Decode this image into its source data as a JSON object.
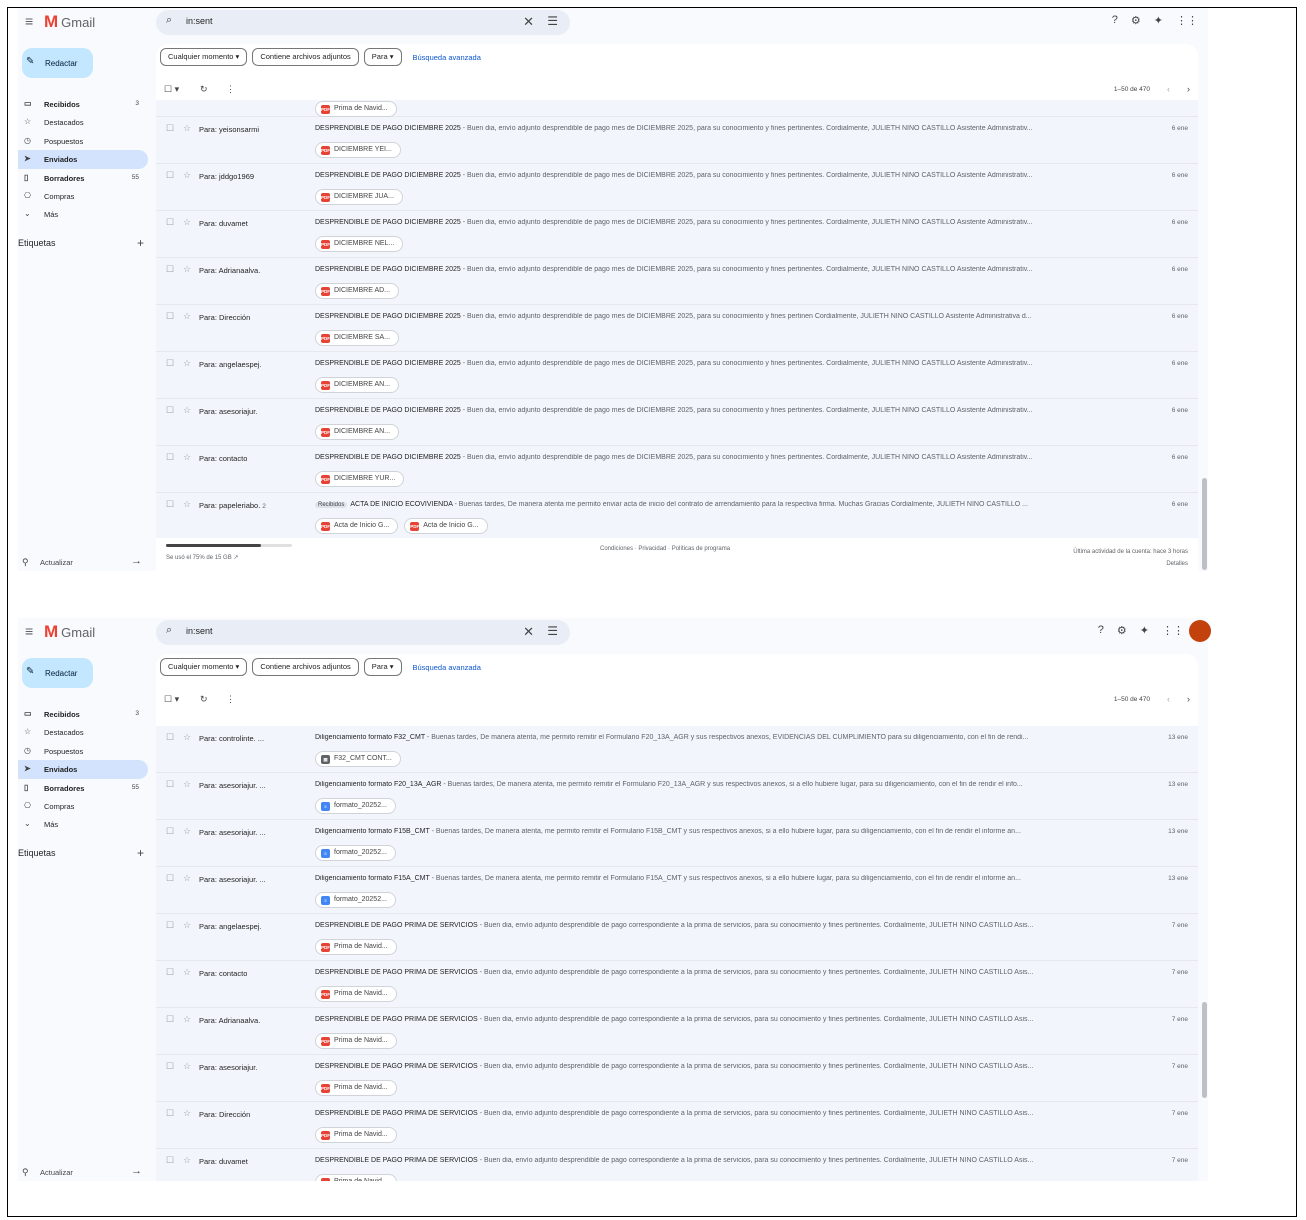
{
  "app": {
    "name": "Gmail"
  },
  "search": {
    "value": "in:sent"
  },
  "compose": {
    "label": "Redactar"
  },
  "nav": [
    {
      "label": "Recibidos",
      "count": "3",
      "icon": "inbox-icon",
      "glyph": "▭",
      "bold": true
    },
    {
      "label": "Destacados",
      "count": "",
      "icon": "star-icon",
      "glyph": "☆"
    },
    {
      "label": "Pospuestos",
      "count": "",
      "icon": "clock-icon",
      "glyph": "◷"
    },
    {
      "label": "Enviados",
      "count": "",
      "icon": "send-icon",
      "glyph": "➤",
      "active": true
    },
    {
      "label": "Borradores",
      "count": "55",
      "icon": "draft-icon",
      "glyph": "▯",
      "bold": true
    },
    {
      "label": "Compras",
      "count": "",
      "icon": "shopping-icon",
      "glyph": "⎔"
    },
    {
      "label": "Más",
      "count": "",
      "icon": "chevron-down-icon",
      "glyph": "⌄"
    }
  ],
  "labels": {
    "title1": "Etiquetas",
    "title2": "Etiquetas"
  },
  "update": {
    "label": "Actualizar"
  },
  "filters": {
    "time": "Cualquier momento",
    "attachments": "Contiene archivos adjuntos",
    "to": "Para",
    "advanced": "Búsqueda avanzada"
  },
  "pagination": {
    "text": "1–50 de 470"
  },
  "footer": {
    "storage": "Se usó el 75% de 15 GB",
    "storage_fraction": 0.75,
    "links": "Condiciones · Privacidad · Políticas de programa",
    "activity": "Última actividad de la cuenta: hace 3 horas",
    "details": "Detalles"
  },
  "shot1": {
    "top_attachment": "Prima de Navid...",
    "rows": [
      {
        "to": "Para: yeisonsarmi",
        "count": "",
        "tag": "",
        "subject": "DESPRENDIBLE DE PAGO DICIEMBRE 2025",
        "snippet": " - Buen dia, envío adjunto desprendible de pago mes de DICIEMBRE 2025, para su conocimiento y fines pertinentes. Cordialmente, JULIETH NIÑO CASTILLO Asistente Administrativ...",
        "date": "6 ene",
        "attachments": [
          {
            "label": "DICIEMBRE YEI...",
            "type": "pdf"
          }
        ]
      },
      {
        "to": "Para: jddgo1969",
        "count": "",
        "tag": "",
        "subject": "DESPRENDIBLE DE PAGO DICIEMBRE 2025",
        "snippet": " - Buen dia, envío adjunto desprendible de pago mes de DICIEMBRE 2025, para su conocimiento y fines pertinentes. Cordialmente, JULIETH NIÑO CASTILLO Asistente Administrativ...",
        "date": "6 ene",
        "attachments": [
          {
            "label": "DICIEMBRE JUA...",
            "type": "pdf"
          }
        ]
      },
      {
        "to": "Para: duvamet",
        "count": "",
        "tag": "",
        "subject": "DESPRENDIBLE DE PAGO DICIEMBRE 2025",
        "snippet": " - Buen dia, envío adjunto desprendible de pago mes de DICIEMBRE 2025, para su conocimiento y fines pertinentes. Cordialmente, JULIETH NIÑO CASTILLO Asistente Administrativ...",
        "date": "6 ene",
        "attachments": [
          {
            "label": "DICIEMBRE NEL...",
            "type": "pdf"
          }
        ]
      },
      {
        "to": "Para: Adrianaalva.",
        "count": "",
        "tag": "",
        "subject": "DESPRENDIBLE DE PAGO DICIEMBRE 2025",
        "snippet": " - Buen dia, envío adjunto desprendible de pago mes de DICIEMBRE 2025, para su conocimiento y fines pertinentes. Cordialmente, JULIETH NIÑO CASTILLO Asistente Administrativ...",
        "date": "6 ene",
        "attachments": [
          {
            "label": "DICIEMBRE AD...",
            "type": "pdf"
          }
        ]
      },
      {
        "to": "Para: Dirección",
        "count": "",
        "tag": "",
        "subject": "DESPRENDIBLE DE PAGO DICIEMBRE 2025",
        "snippet": " - Buen dia, envío adjunto desprendible de pago mes de DICIEMBRE 2025, para su conocimiento y fines pertinen Cordialmente, JULIETH NIÑO CASTILLO Asistente Administrativa d...",
        "date": "6 ene",
        "attachments": [
          {
            "label": "DICIEMBRE SA...",
            "type": "pdf"
          }
        ]
      },
      {
        "to": "Para: angelaespej.",
        "count": "",
        "tag": "",
        "subject": "DESPRENDIBLE DE PAGO DICIEMBRE 2025",
        "snippet": " - Buen dia, envío adjunto desprendible de pago mes de DICIEMBRE 2025, para su conocimiento y fines pertinentes. Cordialmente, JULIETH NIÑO CASTILLO Asistente Administrativ...",
        "date": "6 ene",
        "attachments": [
          {
            "label": "DICIEMBRE AN...",
            "type": "pdf"
          }
        ]
      },
      {
        "to": "Para: asesoriajur.",
        "count": "",
        "tag": "",
        "subject": "DESPRENDIBLE DE PAGO DICIEMBRE 2025",
        "snippet": " - Buen dia, envío adjunto desprendible de pago mes de DICIEMBRE 2025, para su conocimiento y fines pertinentes. Cordialmente, JULIETH NIÑO CASTILLO Asistente Administrativ...",
        "date": "6 ene",
        "attachments": [
          {
            "label": "DICIEMBRE AN...",
            "type": "pdf"
          }
        ]
      },
      {
        "to": "Para: contacto",
        "count": "",
        "tag": "",
        "subject": "DESPRENDIBLE DE PAGO DICIEMBRE 2025",
        "snippet": " - Buen dia, envío adjunto desprendible de pago mes de DICIEMBRE 2025, para su conocimiento y fines pertinentes. Cordialmente, JULIETH NIÑO CASTILLO Asistente Administrativ...",
        "date": "6 ene",
        "attachments": [
          {
            "label": "DICIEMBRE YUR...",
            "type": "pdf"
          }
        ]
      },
      {
        "to": "Para: papeleriabo.",
        "count": "2",
        "tag": "Recibidos",
        "subject": "ACTA DE INICIO ECOVIVIENDA",
        "snippet": " - Buenas tardes, De manera atenta me permito enviar acta de inicio del contrato de arrendamiento para la respectiva firma. Muchas Gracias Cordialmente, JULIETH NIÑO CASTILLO ...",
        "date": "6 ene",
        "attachments": [
          {
            "label": "Acta de Inicio G...",
            "type": "pdf"
          },
          {
            "label": "Acta de Inicio G...",
            "type": "pdf"
          }
        ]
      }
    ]
  },
  "shot2": {
    "rows": [
      {
        "to": "Para: controlinte. ...",
        "count": "",
        "tag": "",
        "subject": "Diligenciamiento formato F32_CMT",
        "snippet": " - Buenas tardes, De manera atenta, me permito remitir el Formulario F20_13A_AGR y sus respectivos anexos, EVIDENCIAS DEL CUMPLIMIENTO para su diligenciamiento, con el fin de rendi...",
        "date": "13 ene",
        "attachments": [
          {
            "label": "F32_CMT CONT...",
            "type": "xls"
          }
        ]
      },
      {
        "to": "Para: asesoriajur. ...",
        "count": "",
        "tag": "",
        "subject": "Diligenciamiento formato F20_13A_AGR",
        "snippet": " - Buenas tardes, De manera atenta, me permito remitir el Formulario F20_13A_AGR y sus respectivos anexos, si a ello hubiere lugar, para su diligenciamiento, con el fin de rendir el info...",
        "date": "13 ene",
        "attachments": [
          {
            "label": "formato_20252...",
            "type": "doc"
          }
        ]
      },
      {
        "to": "Para: asesoriajur. ...",
        "count": "",
        "tag": "",
        "subject": "Diligenciamiento formato F15B_CMT",
        "snippet": " - Buenas tardes, De manera atenta, me permito remitir el Formulario F15B_CMT y sus respectivos anexos, si a ello hubiere lugar, para su diligenciamiento, con el fin de rendir el informe an...",
        "date": "13 ene",
        "attachments": [
          {
            "label": "formato_20252...",
            "type": "doc"
          }
        ]
      },
      {
        "to": "Para: asesoriajur. ...",
        "count": "",
        "tag": "",
        "subject": "Diligenciamiento formato F15A_CMT",
        "snippet": " - Buenas tardes, De manera atenta, me permito remitir el Formulario F15A_CMT y sus respectivos anexos, si a ello hubiere lugar, para su diligenciamiento, con el fin de rendir el informe an...",
        "date": "13 ene",
        "attachments": [
          {
            "label": "formato_20252...",
            "type": "doc"
          }
        ]
      },
      {
        "to": "Para: angelaespej.",
        "count": "",
        "tag": "",
        "subject": "DESPRENDIBLE DE PAGO PRIMA DE SERVICIOS",
        "snippet": " - Buen dia, envío adjunto desprendible de pago correspondiente a la prima de servicios, para su conocimiento y fines pertinentes. Cordialmente, JULIETH NIÑO CASTILLO Asis...",
        "date": "7 ene",
        "attachments": [
          {
            "label": "Prima de Navid...",
            "type": "pdf"
          }
        ]
      },
      {
        "to": "Para: contacto",
        "count": "",
        "tag": "",
        "subject": "DESPRENDIBLE DE PAGO PRIMA DE SERVICIOS",
        "snippet": " - Buen dia, envío adjunto desprendible de pago correspondiente a la prima de servicios, para su conocimiento y fines pertinentes. Cordialmente, JULIETH NIÑO CASTILLO Asis...",
        "date": "7 ene",
        "attachments": [
          {
            "label": "Prima de Navid...",
            "type": "pdf"
          }
        ]
      },
      {
        "to": "Para: Adrianaalva.",
        "count": "",
        "tag": "",
        "subject": "DESPRENDIBLE DE PAGO PRIMA DE SERVICIOS",
        "snippet": " - Buen dia, envío adjunto desprendible de pago correspondiente a la prima de servicios, para su conocimiento y fines pertinentes. Cordialmente, JULIETH NIÑO CASTILLO Asis...",
        "date": "7 ene",
        "attachments": [
          {
            "label": "Prima de Navid...",
            "type": "pdf"
          }
        ]
      },
      {
        "to": "Para: asesoriajur.",
        "count": "",
        "tag": "",
        "subject": "DESPRENDIBLE DE PAGO PRIMA DE SERVICIOS",
        "snippet": " - Buen dia, envío adjunto desprendible de pago correspondiente a la prima de servicios, para su conocimiento y fines pertinentes. Cordialmente, JULIETH NIÑO CASTILLO Asis...",
        "date": "7 ene",
        "attachments": [
          {
            "label": "Prima de Navid...",
            "type": "pdf"
          }
        ]
      },
      {
        "to": "Para: Dirección",
        "count": "",
        "tag": "",
        "subject": "DESPRENDIBLE DE PAGO PRIMA DE SERVICIOS",
        "snippet": " - Buen dia, envío adjunto desprendible de pago correspondiente a la prima de servicios, para su conocimiento y fines pertinentes. Cordialmente, JULIETH NIÑO CASTILLO Asis...",
        "date": "7 ene",
        "attachments": [
          {
            "label": "Prima de Navid...",
            "type": "pdf"
          }
        ]
      },
      {
        "to": "Para: duvamet",
        "count": "",
        "tag": "",
        "subject": "DESPRENDIBLE DE PAGO PRIMA DE SERVICIOS",
        "snippet": " - Buen dia, envío adjunto desprendible de pago correspondiente a la prima de servicios, para su conocimiento y fines pertinentes. Cordialmente, JULIETH NIÑO CASTILLO Asis...",
        "date": "7 ene",
        "attachments": [
          {
            "label": "Prima de Navid...",
            "type": "pdf"
          }
        ]
      }
    ]
  }
}
